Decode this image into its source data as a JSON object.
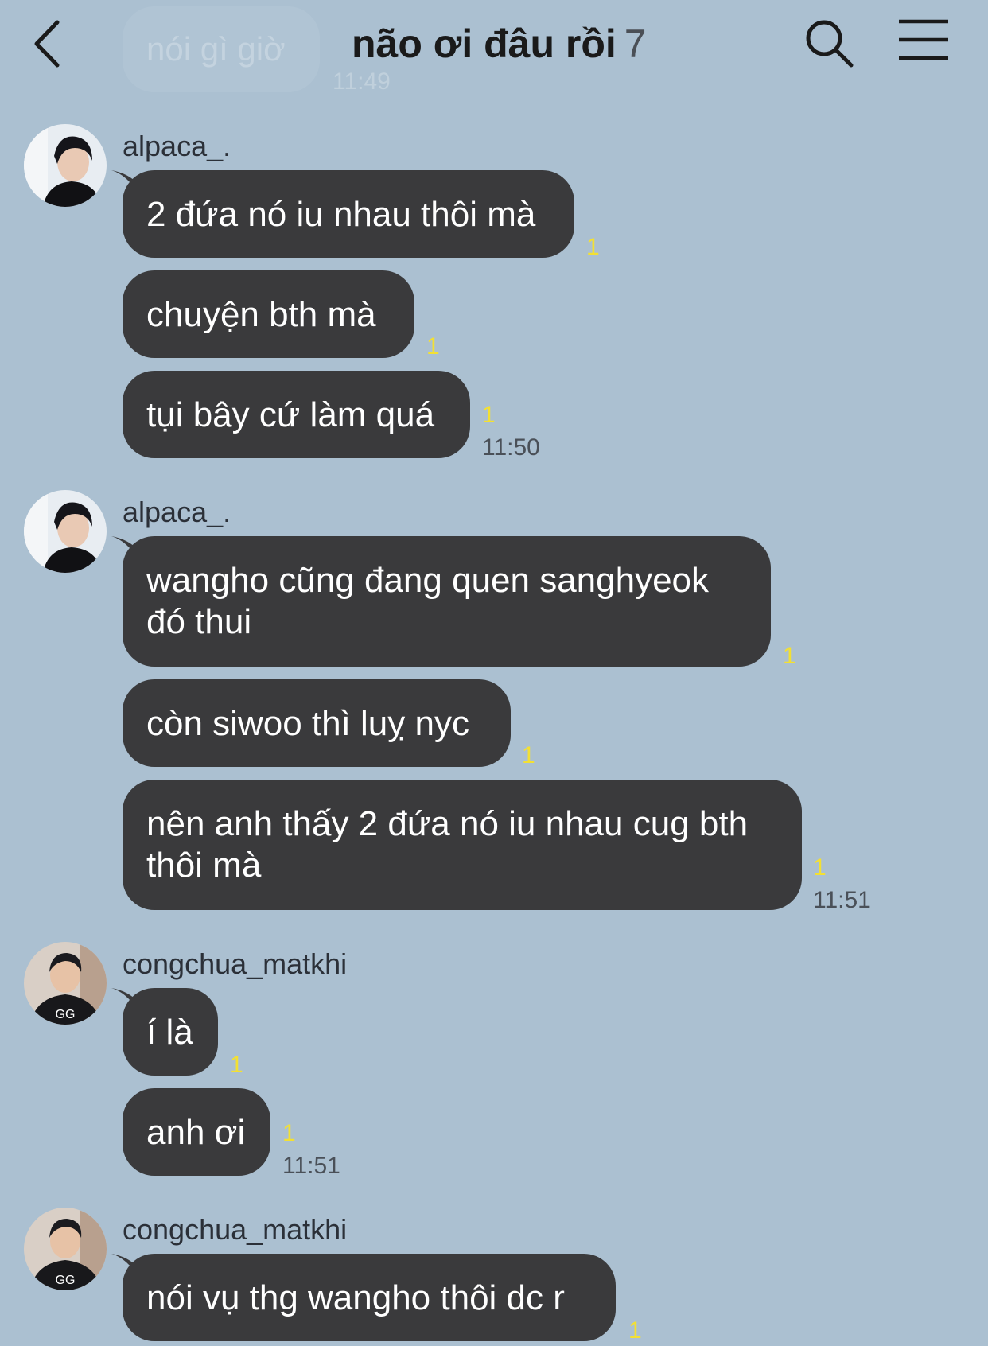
{
  "header": {
    "title": "não ơi đâu rồi",
    "member_count": "7",
    "ghost_message": "nói gì giờ",
    "ghost_time": "11:49",
    "back_icon": "chevron-left-icon",
    "search_icon": "search-icon",
    "menu_icon": "hamburger-menu-icon"
  },
  "groups": [
    {
      "sender": "alpaca_.",
      "messages": [
        {
          "text": "2 đứa nó iu nhau thôi mà",
          "unread": "1"
        },
        {
          "text": "chuyện bth mà",
          "unread": "1"
        },
        {
          "text": "tụi bây cứ làm quá",
          "unread": "1",
          "time": "11:50"
        }
      ]
    },
    {
      "sender": "alpaca_.",
      "messages": [
        {
          "text": "wangho cũng đang quen sanghyeok\nđó thui",
          "unread": "1"
        },
        {
          "text": "còn siwoo thì luỵ nyc",
          "unread": "1"
        },
        {
          "text": "nên anh thấy 2 đứa nó iu nhau cug bth\nthôi mà",
          "unread": "1",
          "time": "11:51"
        }
      ]
    },
    {
      "sender": "congchua_matkhi",
      "messages": [
        {
          "text": "í là",
          "unread": "1"
        },
        {
          "text": "anh ơi",
          "unread": "1",
          "time": "11:51"
        }
      ]
    },
    {
      "sender": "congchua_matkhi",
      "messages": [
        {
          "text": "nói vụ thg wangho thôi dc r",
          "unread": "1"
        }
      ]
    }
  ],
  "colors": {
    "background": "#abc0d1",
    "bubble": "#3a3a3c",
    "unread": "#f3e033"
  }
}
